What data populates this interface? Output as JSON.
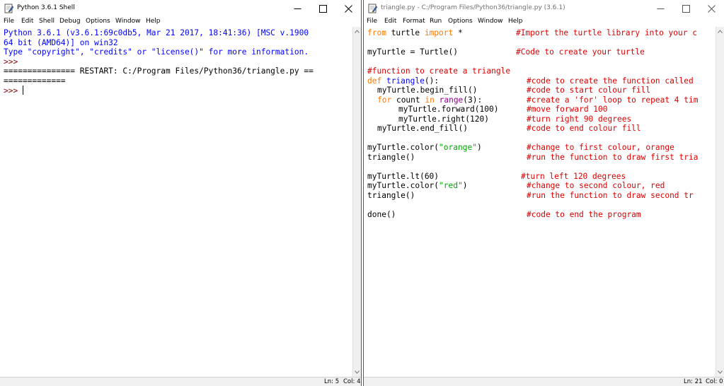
{
  "shell": {
    "title": "Python 3.6.1 Shell",
    "menu": [
      "File",
      "Edit",
      "Shell",
      "Debug",
      "Options",
      "Window",
      "Help"
    ],
    "lines": [
      "Python 3.6.1 (v3.6.1:69c0db5, Mar 21 2017, 18:41:36) [MSC v.1900",
      "64 bit (AMD64)] on win32",
      "Type \"copyright\", \"credits\" or \"license()\" for more information.",
      ">>> ",
      "=============== RESTART: C:/Program Files/Python36/triangle.py ==",
      "=============",
      ">>> "
    ],
    "status": {
      "ln": "Ln: 5",
      "col": "Col: 4"
    }
  },
  "editor": {
    "title": "triangle.py - C:/Program Files/Python36/triangle.py (3.6.1)",
    "menu": [
      "File",
      "Edit",
      "Format",
      "Run",
      "Options",
      "Window",
      "Help"
    ],
    "code": {
      "l1": {
        "kw1": "from",
        "t1": " turtle ",
        "kw2": "import",
        "t2": " *",
        "comment": "#Import the turtle library into your c"
      },
      "l3": {
        "text": "myTurtle = Turtle()",
        "comment": "#Code to create your turtle"
      },
      "l5": {
        "comment": "#function to create a triangle"
      },
      "l6": {
        "kw": "def",
        "name": "triangle",
        "rest": "():",
        "comment": "#code to create the function called"
      },
      "l7": {
        "text": "myTurtle.begin_fill()",
        "comment": "#code to start colour fill"
      },
      "l8": {
        "kw1": "for",
        "t1": " count ",
        "kw2": "in",
        "builtin": "range",
        "t2": "(3):",
        "comment": "#create a 'for' loop to repeat 4 tim"
      },
      "l9": {
        "text": "myTurtle.forward(100)",
        "comment": "#move forward 100"
      },
      "l10": {
        "text": "myTurtle.right(120)",
        "comment": "#turn right 90 degrees"
      },
      "l11": {
        "text": "myTurtle.end_fill()",
        "comment": "#code to end colour fill"
      },
      "l13": {
        "pre": "myTurtle.color(",
        "str": "\"orange\"",
        "post": ")",
        "comment": "#change to first colour, orange"
      },
      "l14": {
        "text": "triangle()",
        "comment": "#run the function to draw first tria"
      },
      "l16": {
        "text": "myTurtle.lt(60)",
        "comment": "#turn left 120 degrees"
      },
      "l17": {
        "pre": "myTurtle.color(",
        "str": "\"red\"",
        "post": ")",
        "comment": "#change to second colour, red"
      },
      "l18": {
        "text": "triangle()",
        "comment": "#run the function to draw second tr"
      },
      "l20": {
        "text": "done()",
        "comment": "#code to end the program"
      }
    },
    "status": {
      "ln": "Ln: 21",
      "col": "Col: 0"
    }
  },
  "colors": {
    "keyword": "#ff7700",
    "comment": "#dd0000",
    "string": "#00aa00",
    "builtin": "#900090",
    "definition": "#0000ff",
    "shell_output": "#0000ff",
    "prompt": "#8b0000"
  },
  "icons": [
    "python-idle-icon",
    "minimize-icon",
    "maximize-icon",
    "close-icon",
    "scroll-up-icon",
    "scroll-down-icon"
  ]
}
